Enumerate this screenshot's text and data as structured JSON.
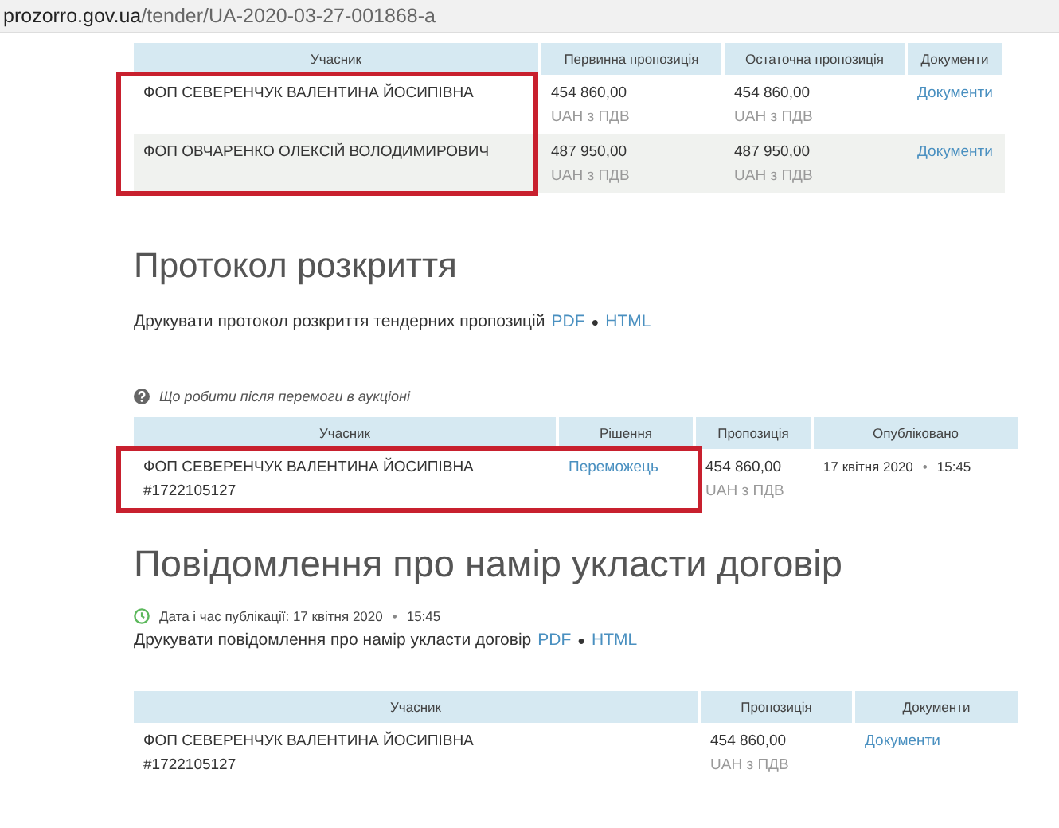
{
  "address_bar": {
    "host": "prozorro.gov.ua",
    "path": "/tender/UA-2020-03-27-001868-a"
  },
  "bids_table": {
    "columns": [
      {
        "label": "Учасник",
        "highlighted": true
      },
      {
        "label": "Первинна пропозиція",
        "highlighted": false
      },
      {
        "label": "Остаточна пропозиція",
        "highlighted": false
      },
      {
        "label": "Документи",
        "highlighted": false
      }
    ],
    "rows": [
      {
        "participant": "ФОП СЕВЕРЕНЧУК ВАЛЕНТИНА ЙОСИПІВНА",
        "initial": "454 860,00",
        "initial_note": "UAH з ПДВ",
        "final": "454 860,00",
        "final_note": "UAH з ПДВ",
        "documents": "Документи",
        "highlighted": true
      },
      {
        "participant": "ФОП ОВЧАРЕНКО ОЛЕКСІЙ ВОЛОДИМИРОВИЧ",
        "initial": "487 950,00",
        "initial_note": "UAH з ПДВ",
        "final": "487 950,00",
        "final_note": "UAH з ПДВ",
        "documents": "Документи",
        "highlighted": true
      }
    ]
  },
  "opening_protocol": {
    "heading": "Протокол розкриття",
    "print_text": "Друкувати протокол розкриття тендерних пропозицій",
    "links": [
      "PDF",
      "HTML"
    ],
    "separator": "●"
  },
  "award": {
    "help_link": "Що робити після перемоги в аукціоні",
    "columns": [
      {
        "label": "Учасник",
        "highlighted": true
      },
      {
        "label": "Рішення",
        "highlighted": true
      },
      {
        "label": "Пропозиція",
        "highlighted": false
      },
      {
        "label": "Опубліковано",
        "highlighted": false
      }
    ],
    "rows": [
      {
        "participant": "ФОП СЕВЕРЕНЧУК ВАЛЕНТИНА ЙОСИПІВНА",
        "id": "#1722105127",
        "decision": "Переможець",
        "amount": "454 860,00",
        "amount_note": "UAH з ПДВ",
        "date": "17 квітня 2020",
        "separator": "•",
        "time": "15:45",
        "highlighted": true
      }
    ]
  },
  "intent_notice": {
    "heading": "Повідомлення про намір укласти договір",
    "date_label": "Дата і час публікації: 17 квітня 2020",
    "separator": "•",
    "time": "15:45",
    "print_text": "Друкувати повідомлення про намір укласти договір",
    "links": [
      "PDF",
      "HTML"
    ],
    "link_separator": "●",
    "columns": [
      {
        "label": "Учасник"
      },
      {
        "label": "Пропозиція"
      },
      {
        "label": "Документи"
      }
    ],
    "rows": [
      {
        "participant": "ФОП СЕВЕРЕНЧУК ВАЛЕНТИНА ЙОСИПІВНА",
        "id": "#1722105127",
        "amount": "454 860,00",
        "amount_note": "UAH з ПДВ",
        "documents": "Документи"
      }
    ]
  }
}
